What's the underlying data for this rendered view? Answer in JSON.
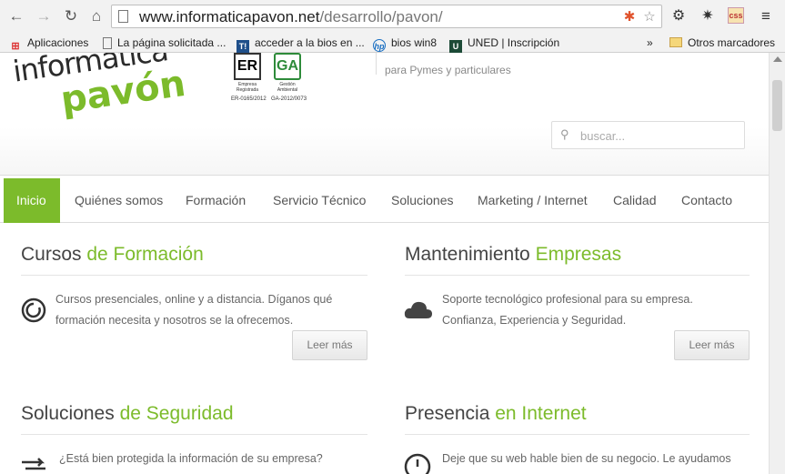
{
  "browser": {
    "url_host": "www.informaticapavon.net",
    "url_path": "/desarrollo/pavon/",
    "icons": [
      "back-icon",
      "forward-icon",
      "reload-icon",
      "home-icon",
      "page-icon",
      "joomla-icon",
      "star-icon",
      "gear-icon",
      "bug-icon",
      "css-icon",
      "menu-icon"
    ]
  },
  "bookmarks": {
    "items": [
      {
        "label": "Aplicaciones",
        "icon": "apps-grid-icon"
      },
      {
        "label": "La página solicitada ...",
        "icon": "page-icon"
      },
      {
        "label": "acceder a la bios en ...",
        "icon": "t-icon"
      },
      {
        "label": "bios win8",
        "icon": "hp-icon"
      },
      {
        "label": "UNED | Inscripción",
        "icon": "uned-icon"
      }
    ],
    "overflow": "»",
    "other": "Otros marcadores"
  },
  "site": {
    "logo_line1": "informática",
    "logo_line2": "pavón",
    "cert1": {
      "letters": "ER",
      "text": "Empresa Registrada",
      "code": "ER-0165/2012"
    },
    "cert2": {
      "letters": "GA",
      "text": "Gestión Ambiental",
      "code": "GA-2012/0073"
    },
    "tagline": "para Pymes y particulares",
    "search_placeholder": "buscar..."
  },
  "menu": {
    "items": [
      "Inicio",
      "Quiénes somos",
      "Formación",
      "Servicio Técnico",
      "Soluciones",
      "Marketing / Internet",
      "Calidad",
      "Contacto"
    ],
    "active": "Inicio"
  },
  "sections": [
    {
      "title": "Cursos ",
      "title_green": "de Formación",
      "icon": "power-icon",
      "line1": "Cursos presenciales, online y a distancia. Díganos qué",
      "line2": "formación necesita y nosotros se la ofrecemos.",
      "button": "Leer más"
    },
    {
      "title": "Mantenimiento ",
      "title_green": "Empresas",
      "icon": "cloud-icon",
      "line1": "Soporte tecnológico profesional para su empresa.",
      "line2": "Confianza, Experiencia y Seguridad.",
      "button": "Leer más"
    },
    {
      "title": "Soluciones ",
      "title_green": "de Seguridad",
      "icon": "arrows-icon",
      "line1": "¿Está bien protegida la información de su empresa?"
    },
    {
      "title": "Presencia ",
      "title_green": "en Internet",
      "icon": "clock-icon",
      "line1": "Deje que su web hable bien de su negocio. Le ayudamos"
    }
  ],
  "colors": {
    "accent": "#7cbb2b",
    "text": "#666666",
    "title": "#444444"
  }
}
